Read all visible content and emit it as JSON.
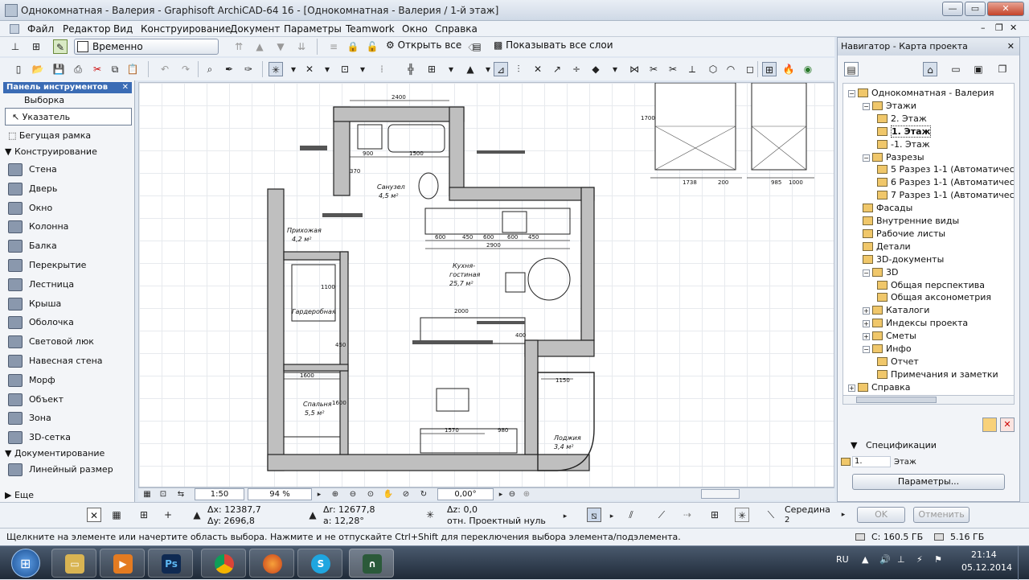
{
  "window": {
    "title": "Однокомнатная - Валерия - Graphisoft ArchiCAD-64 16 - [Однокомнатная - Валерия / 1-й этаж]",
    "min_label": "—",
    "max_label": "▭",
    "close_label": "✕",
    "doc_min_label": "–",
    "doc_restore_label": "❐",
    "doc_close_label": "✕"
  },
  "menu": [
    "Файл",
    "Редактор",
    "Вид",
    "Конструирование",
    "Документ",
    "Параметры",
    "Teamwork",
    "Окно",
    "Справка"
  ],
  "toolbar1": {
    "ungroup_label": "Временно разгруппировать",
    "open_all_label": "Открыть все",
    "show_layers_label": "Показывать все слои"
  },
  "toolbox": {
    "title": "Панель инструментов",
    "close": "✕",
    "select_group": "Выборка",
    "tools_select": [
      "Указатель",
      "Бегущая рамка"
    ],
    "construct_group": "Конструирование",
    "tools_construct": [
      "Стена",
      "Дверь",
      "Окно",
      "Колонна",
      "Балка",
      "Перекрытие",
      "Лестница",
      "Крыша",
      "Оболочка",
      "Световой люк",
      "Навесная стена",
      "Морф",
      "Объект",
      "Зона",
      "3D-сетка"
    ],
    "document_group": "Документирование",
    "tools_document": [
      "Линейный размер"
    ],
    "more": "Еще"
  },
  "plan_labels": {
    "hall": "Прихожая",
    "hall_area": "4,2 м²",
    "bath": "Санузел",
    "bath_area": "4,5 м²",
    "kitchen": "Кухня-",
    "kitchen2": "гостиная",
    "kitchen_area": "25,7 м²",
    "bedroom": "Спальня",
    "bedroom_area": "5,5 м²",
    "loggia": "Лоджия",
    "loggia_area": "3,4 м²",
    "wardrobe": "Гардеробная",
    "dims": [
      "2400",
      "1500",
      "900",
      "370",
      "600",
      "450",
      "600",
      "600",
      "450",
      "2900",
      "1100",
      "1600",
      "1600",
      "450",
      "2000",
      "1570",
      "980",
      "1150",
      "400",
      "1738",
      "200",
      "985",
      "1000",
      "1700"
    ]
  },
  "bottom": {
    "scale": "1:50",
    "zoom": "94 %",
    "angle": "0,00°"
  },
  "infobox": {
    "dx": "Δx: 12387,7",
    "dy": "Δy: 2696,8",
    "dr": "Δr: 12677,8",
    "a": "a: 12,28°",
    "dz": "Δz: 0,0",
    "ref": "отн. Проектный нуль",
    "snap_label": "Середина",
    "snap_count": "2",
    "ok": "OK",
    "cancel": "Отменить"
  },
  "navigator": {
    "title": "Навигатор - Карта проекта",
    "close": "✕",
    "tree": [
      {
        "label": "Однокомнатная - Валерия",
        "level": 0,
        "pm": "-",
        "bold": false
      },
      {
        "label": "Этажи",
        "level": 1,
        "pm": "-",
        "bold": false
      },
      {
        "label": "2. Этаж",
        "level": 2,
        "pm": "",
        "bold": false
      },
      {
        "label": "1. Этаж",
        "level": 2,
        "pm": "",
        "bold": true
      },
      {
        "label": "-1. Этаж",
        "level": 2,
        "pm": "",
        "bold": false
      },
      {
        "label": "Разрезы",
        "level": 1,
        "pm": "-",
        "bold": false
      },
      {
        "label": "5 Разрез 1-1 (Автоматичес",
        "level": 2,
        "pm": "",
        "bold": false
      },
      {
        "label": "6 Разрез 1-1 (Автоматичес",
        "level": 2,
        "pm": "",
        "bold": false
      },
      {
        "label": "7 Разрез 1-1 (Автоматичес",
        "level": 2,
        "pm": "",
        "bold": false
      },
      {
        "label": "Фасады",
        "level": 1,
        "pm": "",
        "bold": false
      },
      {
        "label": "Внутренние виды",
        "level": 1,
        "pm": "",
        "bold": false
      },
      {
        "label": "Рабочие листы",
        "level": 1,
        "pm": "",
        "bold": false
      },
      {
        "label": "Детали",
        "level": 1,
        "pm": "",
        "bold": false
      },
      {
        "label": "3D-документы",
        "level": 1,
        "pm": "",
        "bold": false
      },
      {
        "label": "3D",
        "level": 1,
        "pm": "-",
        "bold": false
      },
      {
        "label": "Общая перспектива",
        "level": 2,
        "pm": "",
        "bold": false
      },
      {
        "label": "Общая аксонометрия",
        "level": 2,
        "pm": "",
        "bold": false
      },
      {
        "label": "Каталоги",
        "level": 1,
        "pm": "+",
        "bold": false
      },
      {
        "label": "Индексы проекта",
        "level": 1,
        "pm": "+",
        "bold": false
      },
      {
        "label": "Сметы",
        "level": 1,
        "pm": "+",
        "bold": false
      },
      {
        "label": "Инфо",
        "level": 1,
        "pm": "-",
        "bold": false
      },
      {
        "label": "Отчет",
        "level": 2,
        "pm": "",
        "bold": false
      },
      {
        "label": "Примечания и заметки",
        "level": 2,
        "pm": "",
        "bold": false
      },
      {
        "label": "Справка",
        "level": 0,
        "pm": "+",
        "bold": false
      }
    ],
    "specs_label": "Спецификации",
    "field_value": "1.",
    "field_label": "Этаж",
    "params_button": "Параметры..."
  },
  "status": {
    "hint": "Щелкните на элементе или начертите область выбора. Нажмите и не отпускайте Ctrl+Shift для переключения выбора элемента/подэлемента.",
    "disk1": "C: 160.5 ГБ",
    "disk2": "5.16 ГБ"
  },
  "taskbar": {
    "lang": "RU",
    "time": "21:14",
    "date": "05.12.2014",
    "apps": [
      "Проводник",
      "Media",
      "Ps",
      "Chrome",
      "Firefox",
      "Skype",
      "ArchiCAD"
    ]
  },
  "colors": {
    "accent": "#3b6cb5",
    "taskbar": "#2b3a4e"
  }
}
